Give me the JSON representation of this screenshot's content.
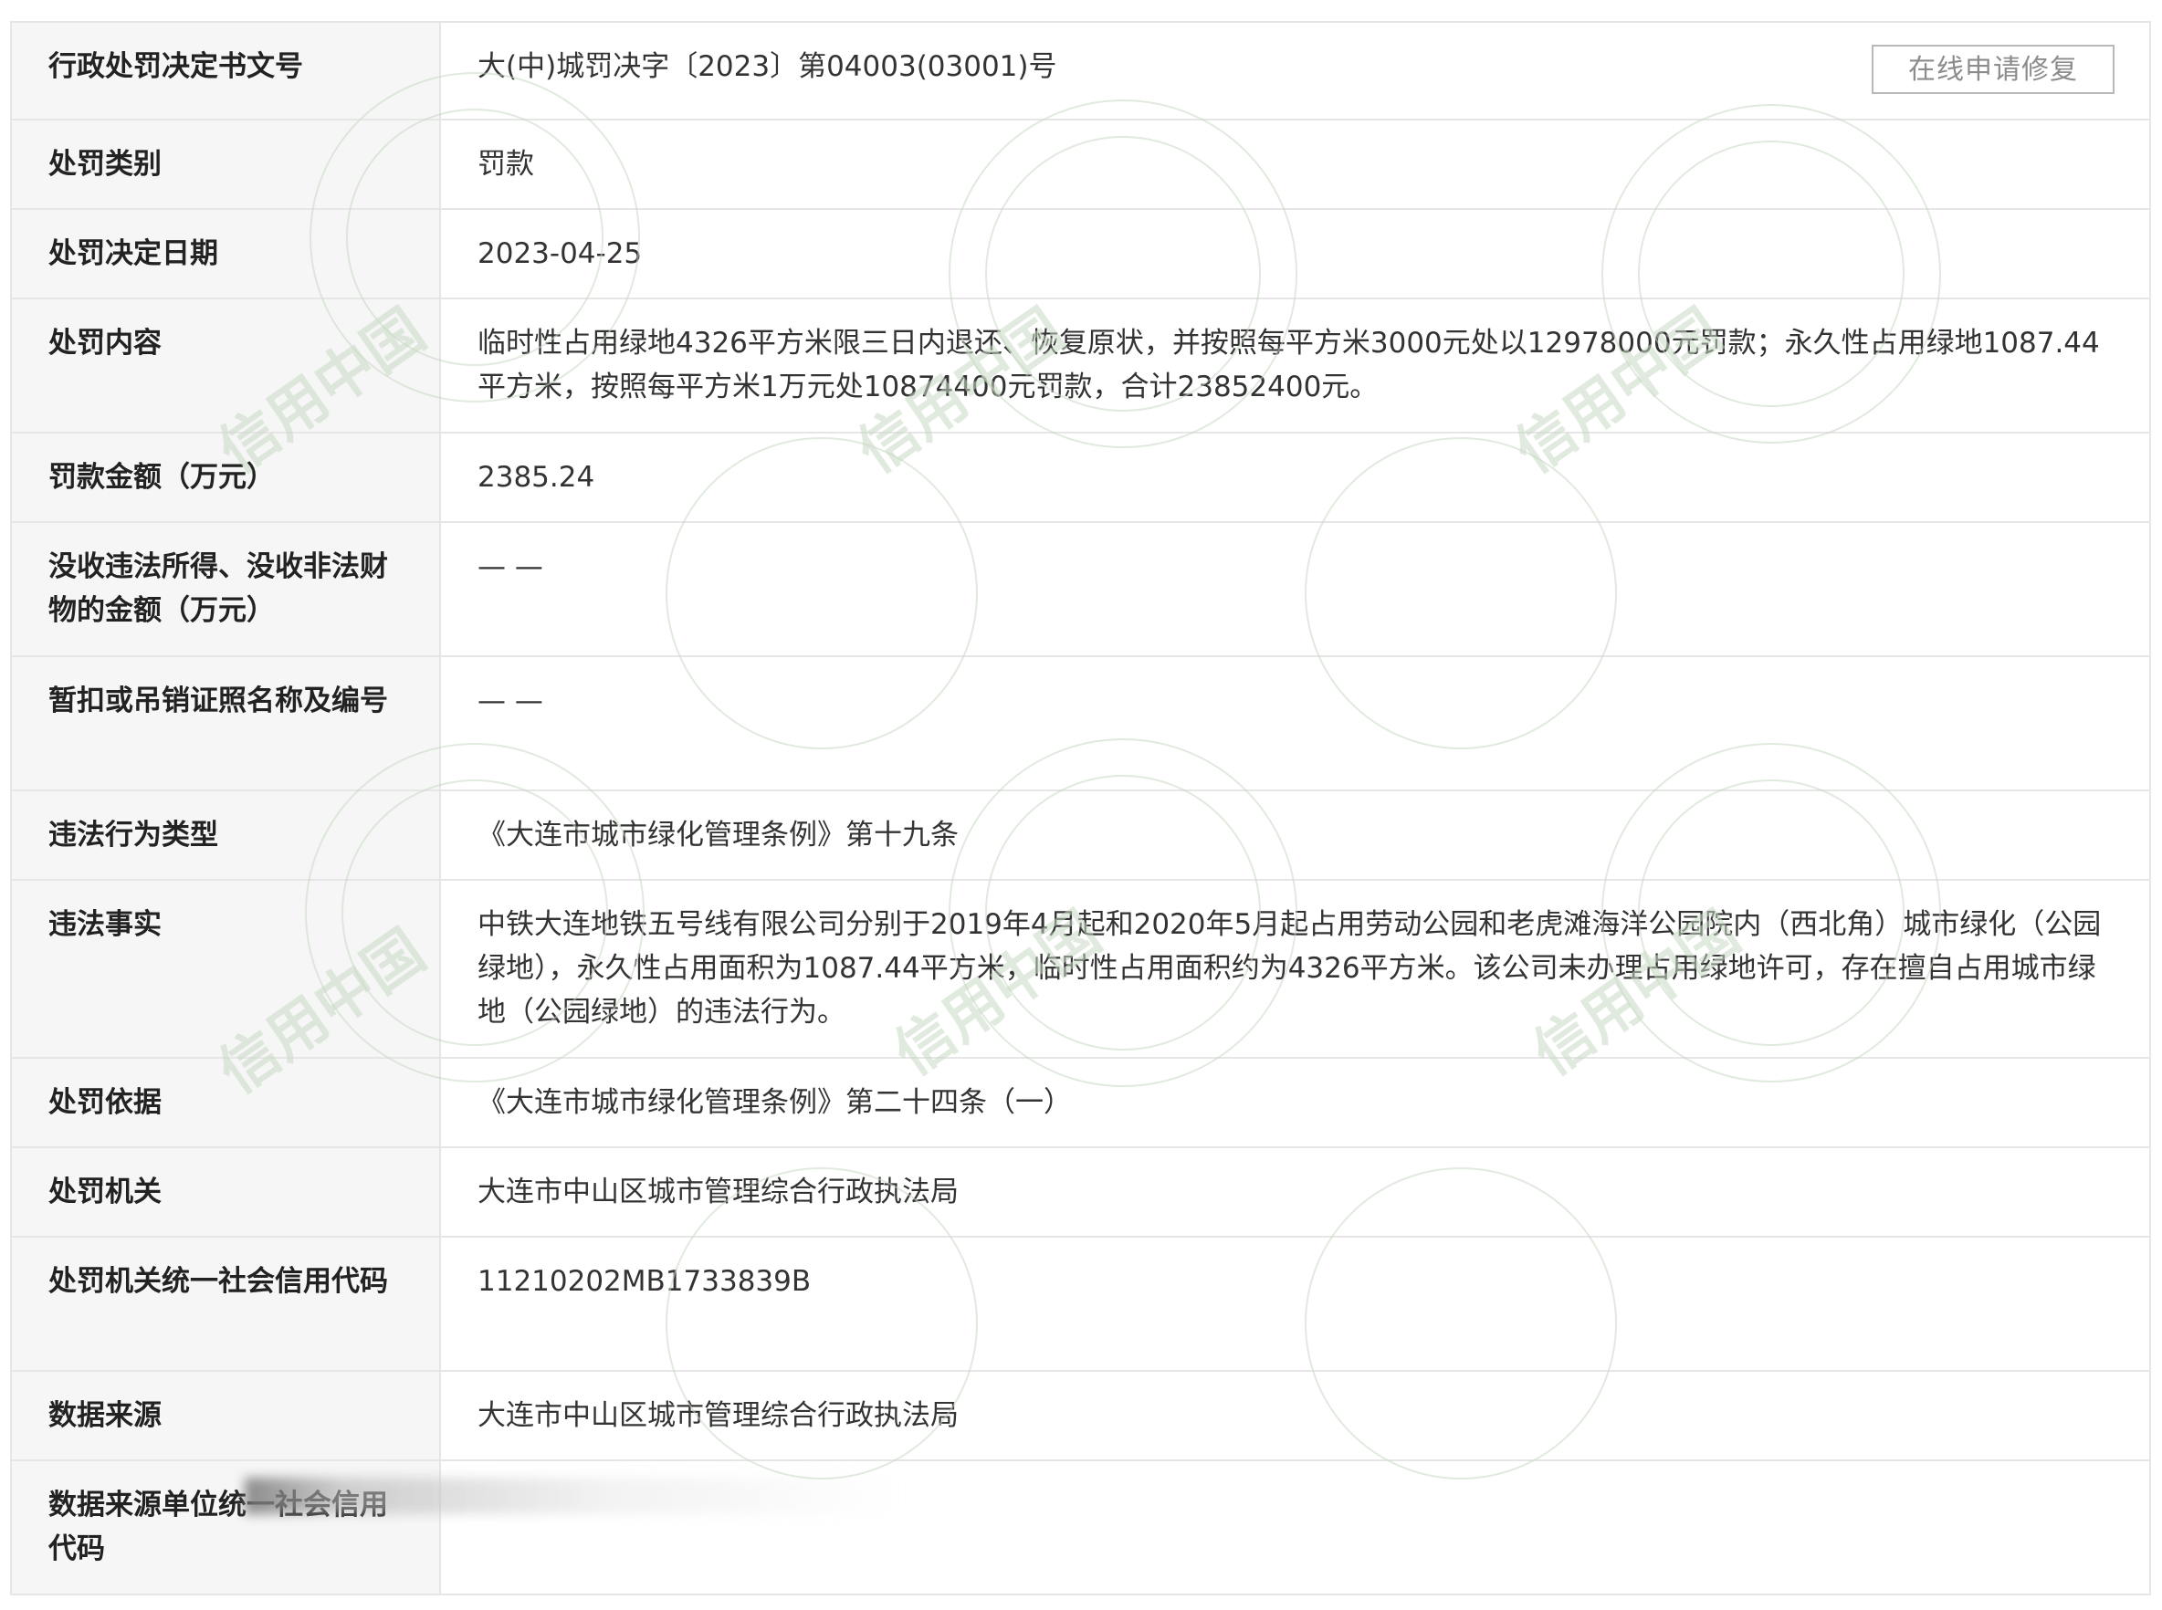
{
  "repair_button_label": "在线申请修复",
  "rows": [
    {
      "label": "行政处罚决定书文号",
      "value": "大(中)城罚决字〔2023〕第04003(03001)号"
    },
    {
      "label": "处罚类别",
      "value": "罚款"
    },
    {
      "label": "处罚决定日期",
      "value": "2023-04-25"
    },
    {
      "label": "处罚内容",
      "value": "临时性占用绿地4326平方米限三日内退还、恢复原状，并按照每平方米3000元处以12978000元罚款；永久性占用绿地1087.44平方米，按照每平方米1万元处10874400元罚款，合计23852400元。"
    },
    {
      "label": "罚款金额（万元）",
      "value": "2385.24"
    },
    {
      "label": "没收违法所得、没收非法财物的金额（万元）",
      "value": "— —"
    },
    {
      "label": "暂扣或吊销证照名称及编号",
      "value": "— —"
    },
    {
      "label": "违法行为类型",
      "value": "《大连市城市绿化管理条例》第十九条"
    },
    {
      "label": "违法事实",
      "value": "中铁大连地铁五号线有限公司分别于2019年4月起和2020年5月起占用劳动公园和老虎滩海洋公园院内（西北角）城市绿化（公园绿地），永久性占用面积为1087.44平方米，临时性占用面积约为4326平方米。该公司未办理占用绿地许可，存在擅自占用城市绿地（公园绿地）的违法行为。"
    },
    {
      "label": "处罚依据",
      "value": "《大连市城市绿化管理条例》第二十四条（一）"
    },
    {
      "label": "处罚机关",
      "value": "大连市中山区城市管理综合行政执法局"
    },
    {
      "label": "处罚机关统一社会信用代码",
      "value": "11210202MB1733839B"
    },
    {
      "label": "数据来源",
      "value": "大连市中山区城市管理综合行政执法局"
    },
    {
      "label": "数据来源单位统一社会信用代码",
      "value": ""
    }
  ],
  "watermark_text": "信用中国",
  "colors": {
    "label_bg": "#f6f6f6",
    "border": "#e6e6e6",
    "watermark": "#c8d9c4"
  }
}
